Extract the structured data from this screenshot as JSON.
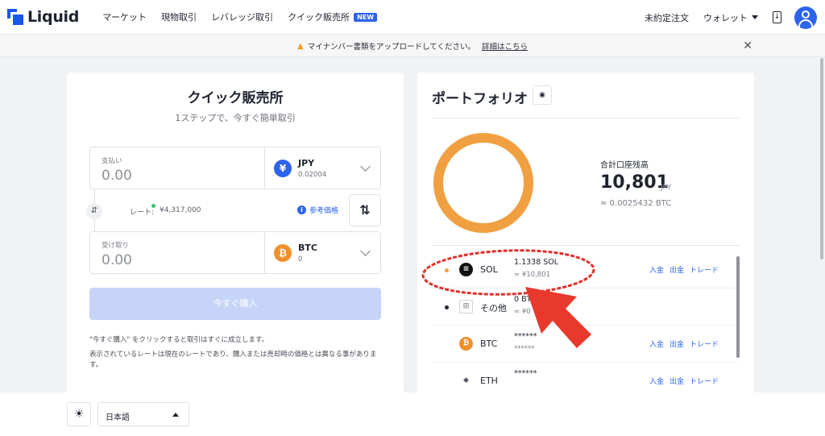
{
  "brand": {
    "name": "Liquid",
    "color": "#1a56e8"
  },
  "nav": {
    "items": [
      {
        "label": "マーケット"
      },
      {
        "label": "現物取引"
      },
      {
        "label": "レバレッジ取引"
      },
      {
        "label": "クイック販売所",
        "badge": "NEW"
      }
    ],
    "right": {
      "open_orders": "未約定注文",
      "wallet": "ウォレット"
    }
  },
  "notice": {
    "text": "マイナンバー書類をアップロードしてください。",
    "link": "詳細はこちら"
  },
  "quick": {
    "title": "クイック販売所",
    "subtitle": "1ステップで、今すぐ簡単取引",
    "pay": {
      "label": "支払い",
      "amount": "0.00",
      "currency": "JPY",
      "currency_sub": "0.02004",
      "icon": "yen-icon",
      "icon_glyph": "¥",
      "icon_color": "#2c63ea"
    },
    "receive": {
      "label": "受け取り",
      "amount": "0.00",
      "currency": "BTC",
      "currency_sub": "0",
      "icon": "bitcoin-icon",
      "icon_glyph": "₿",
      "icon_color": "#f0902a"
    },
    "rate_label": "レート:",
    "rate_value": "¥4,317,000",
    "ref_price": "参考価格",
    "swap_glyph": "⇅",
    "buy_button": "今すぐ購入",
    "note1": "\"今すぐ購入\" をクリックすると取引はすぐに成立します。",
    "note2": "表示されているレートは現在のレートであり、購入または売却時の価格とは異なる事がありま す。"
  },
  "portfolio": {
    "title": "ポートフォリオ",
    "total_label": "合計口座残高",
    "total_amount": "10,801",
    "total_currency": "JPY",
    "total_btc": "≈ 0.0025432 BTC",
    "donut_color": "#f0a040",
    "rows": [
      {
        "dot_color": "#f0a040",
        "icon": "solana-icon",
        "icon_glyph": "≡",
        "icon_color": "#111111",
        "name": "SOL",
        "amount": "1.1338 SOL",
        "jpy": "≈ ¥10,801",
        "deposit": "入金",
        "withdraw": "出金",
        "trade": "トレード"
      },
      {
        "dot_color": "#1f2330",
        "icon": "grid-icon",
        "icon_glyph": "⊞",
        "icon_color": "#ffffff",
        "name": "その他",
        "amount": "0 BTC",
        "jpy": "≈ ¥0",
        "deposit": "",
        "withdraw": "",
        "trade": ""
      },
      {
        "dot_color": "#ffffff",
        "icon": "bitcoin-icon",
        "icon_glyph": "₿",
        "icon_color": "#f0902a",
        "name": "BTC",
        "amount": "******",
        "jpy": "******",
        "deposit": "入金",
        "withdraw": "出金",
        "trade": "トレード"
      },
      {
        "dot_color": "#ffffff",
        "icon": "ethereum-icon",
        "icon_glyph": "◆",
        "icon_color": "#555a66",
        "name": "ETH",
        "amount": "******",
        "jpy": "",
        "deposit": "入金",
        "withdraw": "出金",
        "trade": "トレード"
      }
    ]
  },
  "footer": {
    "theme_glyph": "☀",
    "language": "日本語"
  }
}
